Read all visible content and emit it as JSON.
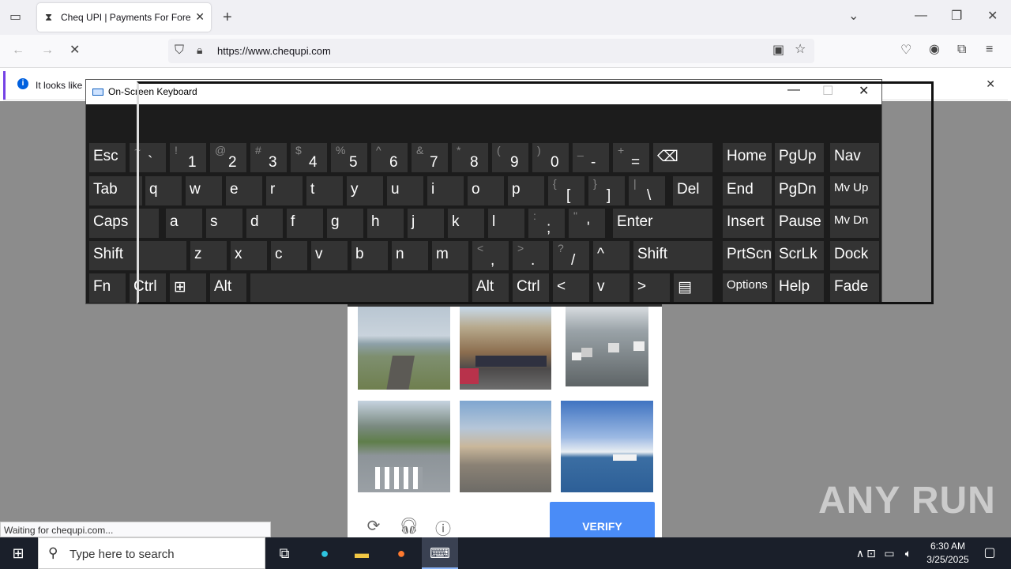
{
  "browser": {
    "tab_title": "Cheq UPI | Payments For Foreign",
    "url": "https://www.chequpi.com",
    "notification_text": "It looks like",
    "status_text": "Waiting for chequpi.com..."
  },
  "osk": {
    "title": "On-Screen Keyboard",
    "rows": [
      [
        {
          "m": "Esc"
        },
        {
          "up": "~",
          "lo": "`"
        },
        {
          "up": "!",
          "lo": "1"
        },
        {
          "up": "@",
          "lo": "2"
        },
        {
          "up": "#",
          "lo": "3"
        },
        {
          "up": "$",
          "lo": "4"
        },
        {
          "up": "%",
          "lo": "5"
        },
        {
          "up": "^",
          "lo": "6"
        },
        {
          "up": "&",
          "lo": "7"
        },
        {
          "up": "*",
          "lo": "8"
        },
        {
          "up": "(",
          "lo": "9"
        },
        {
          "up": ")",
          "lo": "0"
        },
        {
          "up": "_",
          "lo": "-"
        },
        {
          "up": "+",
          "lo": "="
        },
        {
          "m": "⌫"
        },
        {
          "m": "Home"
        },
        {
          "m": "PgUp"
        },
        {
          "m": "Nav"
        }
      ],
      [
        {
          "m": "Tab"
        },
        {
          "m": "q"
        },
        {
          "m": "w"
        },
        {
          "m": "e"
        },
        {
          "m": "r"
        },
        {
          "m": "t"
        },
        {
          "m": "y"
        },
        {
          "m": "u"
        },
        {
          "m": "i"
        },
        {
          "m": "o"
        },
        {
          "m": "p"
        },
        {
          "up": "{",
          "lo": "["
        },
        {
          "up": "}",
          "lo": "]"
        },
        {
          "up": "|",
          "lo": "\\"
        },
        {
          "m": "Del"
        },
        {
          "m": "End"
        },
        {
          "m": "PgDn"
        },
        {
          "m": "Mv Up"
        }
      ],
      [
        {
          "m": "Caps"
        },
        {
          "m": "a"
        },
        {
          "m": "s"
        },
        {
          "m": "d"
        },
        {
          "m": "f"
        },
        {
          "m": "g"
        },
        {
          "m": "h"
        },
        {
          "m": "j"
        },
        {
          "m": "k"
        },
        {
          "m": "l"
        },
        {
          "up": ":",
          "lo": ";"
        },
        {
          "up": "\"",
          "lo": "'"
        },
        {
          "m": "Enter"
        },
        {
          "m": "Insert"
        },
        {
          "m": "Pause"
        },
        {
          "m": "Mv Dn"
        }
      ],
      [
        {
          "m": "Shift"
        },
        {
          "m": "z"
        },
        {
          "m": "x"
        },
        {
          "m": "c"
        },
        {
          "m": "v"
        },
        {
          "m": "b"
        },
        {
          "m": "n"
        },
        {
          "m": "m"
        },
        {
          "up": "<",
          "lo": ","
        },
        {
          "up": ">",
          "lo": "."
        },
        {
          "up": "?",
          "lo": "/"
        },
        {
          "m": "^"
        },
        {
          "m": "Shift"
        },
        {
          "m": "PrtScn"
        },
        {
          "m": "ScrLk"
        },
        {
          "m": "Dock"
        }
      ],
      [
        {
          "m": "Fn"
        },
        {
          "m": "Ctrl"
        },
        {
          "m": "⊞"
        },
        {
          "m": "Alt"
        },
        {
          "m": ""
        },
        {
          "m": "Alt"
        },
        {
          "m": "Ctrl"
        },
        {
          "m": "<"
        },
        {
          "m": "v"
        },
        {
          "m": ">"
        },
        {
          "m": "▤"
        },
        {
          "m": "Options"
        },
        {
          "m": "Help"
        },
        {
          "m": "Fade"
        }
      ]
    ]
  },
  "captcha": {
    "verify_label": "VERIFY"
  },
  "taskbar": {
    "search_placeholder": "Type here to search",
    "time": "6:30 AM",
    "date": "3/25/2025"
  },
  "watermark": "ANY RUN"
}
